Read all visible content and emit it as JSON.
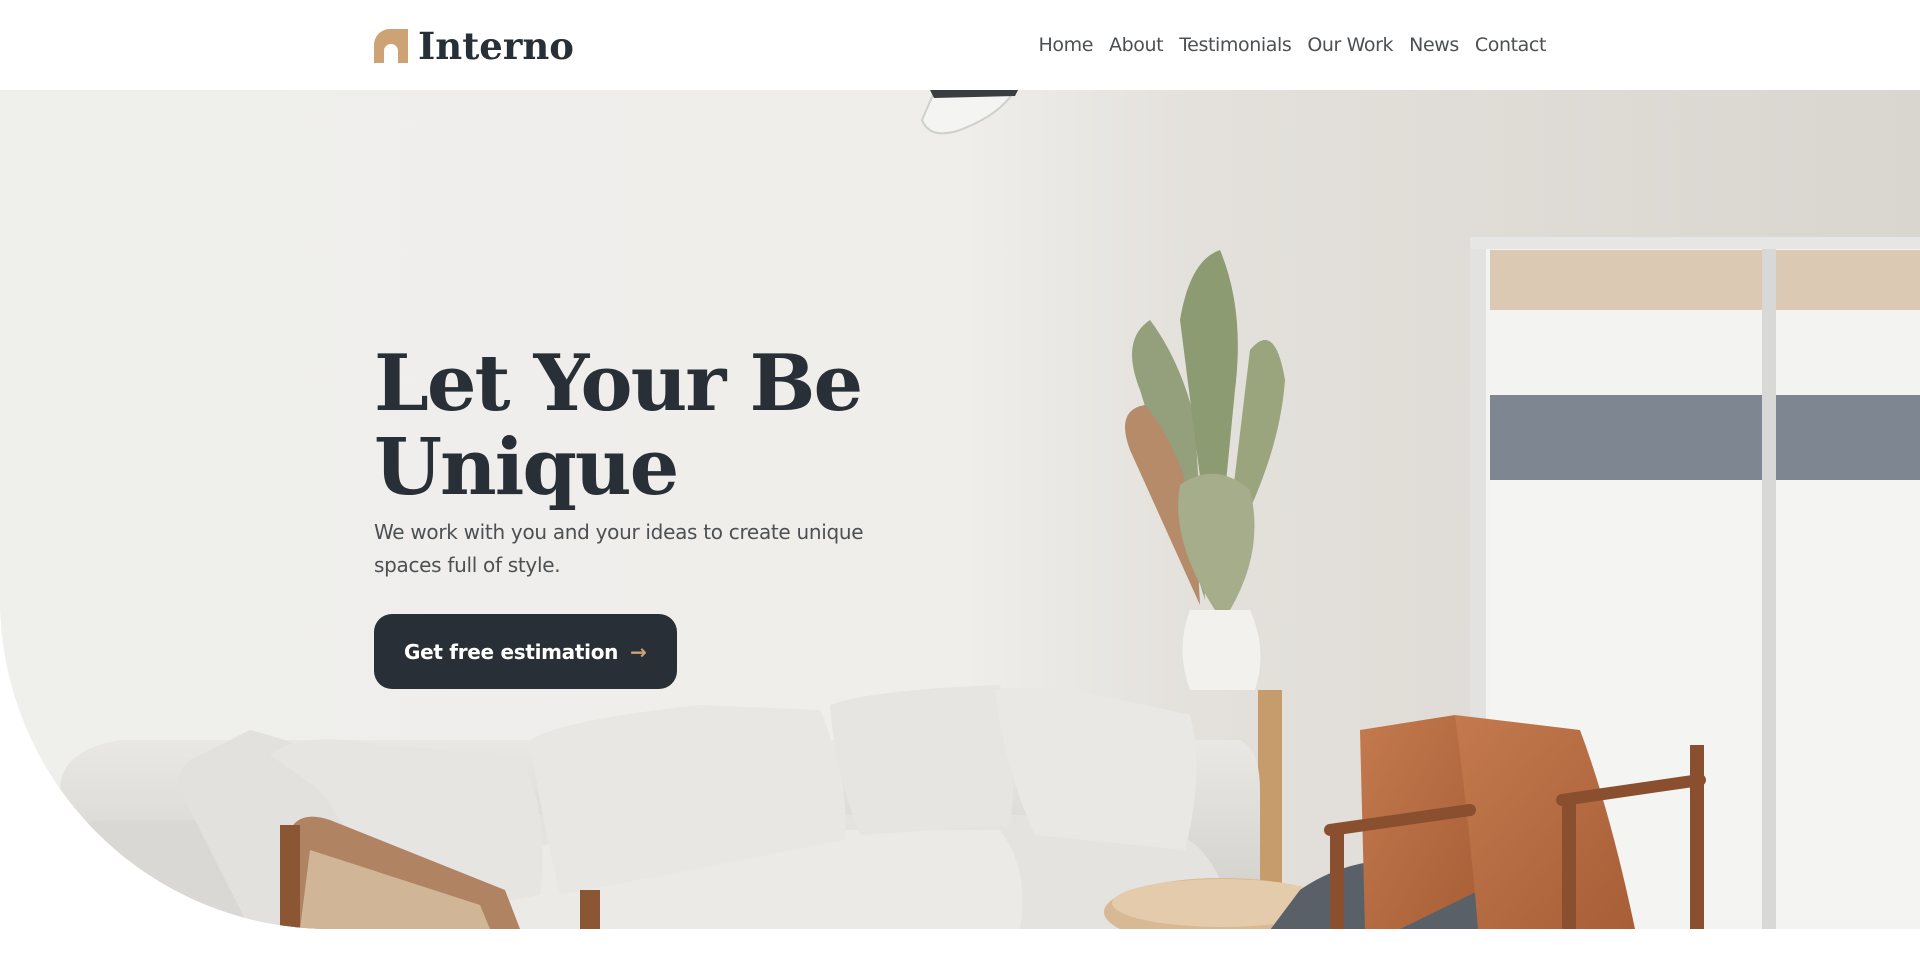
{
  "brand": {
    "name": "Interno",
    "accent": "#cda274",
    "dark": "#292f36"
  },
  "nav": {
    "items": [
      "Home",
      "About",
      "Testimonials",
      "Our Work",
      "News",
      "Contact"
    ]
  },
  "hero": {
    "title_line1": "Let Your Be",
    "title_line2": "Unique",
    "subtitle": "We work with you and your ideas to create unique spaces full of style.",
    "cta_label": "Get free estimation",
    "cta_icon": "arrow-right-icon"
  }
}
